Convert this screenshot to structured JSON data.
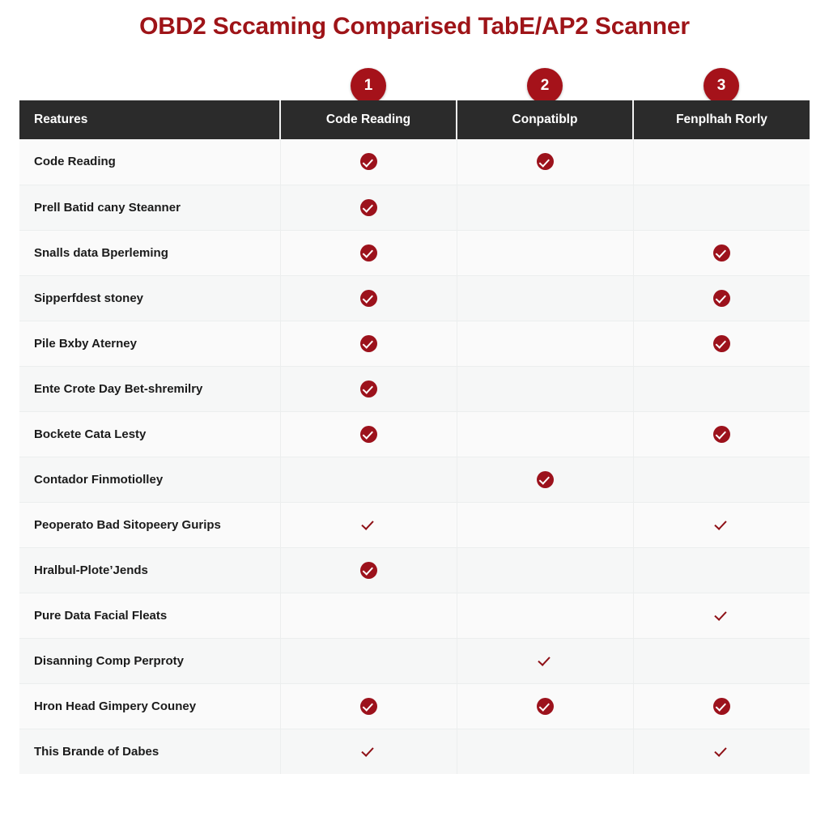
{
  "title": "OBD2 Sccaming Comparised TabE/AP2 Scanner",
  "colors": {
    "title": "#9e1418",
    "header_bar": "#2b2b2b",
    "badge": "#a5121a",
    "check": "#9c121c",
    "page_background": "#ffffff"
  },
  "badges": [
    {
      "label": "1"
    },
    {
      "label": "2"
    },
    {
      "label": "3"
    }
  ],
  "table": {
    "columns": [
      {
        "label": "Reatures",
        "type": "feature"
      },
      {
        "label": "Code Reading",
        "type": "mark"
      },
      {
        "label": "Conpatiblp",
        "type": "mark"
      },
      {
        "label": "Fenplhah Rorly",
        "type": "mark"
      }
    ],
    "rows": [
      {
        "feature": "Code Reading",
        "marks": [
          "circle",
          "circle",
          "none"
        ]
      },
      {
        "feature": "Prell Batid cany Steanner",
        "marks": [
          "circle",
          "none",
          "none"
        ]
      },
      {
        "feature": "Snalls data Bperleming",
        "marks": [
          "circle",
          "none",
          "circle"
        ]
      },
      {
        "feature": "Sipperfdest stoney",
        "marks": [
          "circle",
          "none",
          "circle"
        ]
      },
      {
        "feature": "Pile Bxby Aterney",
        "marks": [
          "circle",
          "none",
          "circle"
        ]
      },
      {
        "feature": "Ente Crote Day Bet-shremilry",
        "marks": [
          "circle",
          "none",
          "none"
        ]
      },
      {
        "feature": "Bockete Cata Lesty",
        "marks": [
          "circle",
          "none",
          "circle"
        ]
      },
      {
        "feature": "Contador Finmotiolley",
        "marks": [
          "none",
          "circle",
          "none"
        ]
      },
      {
        "feature": "Peoperato Bad Sitopeery Gurips",
        "marks": [
          "plain",
          "none",
          "plain"
        ]
      },
      {
        "feature": "Hralbul-Plote’Jends",
        "marks": [
          "circle",
          "none",
          "none"
        ]
      },
      {
        "feature": "Pure Data Facial Fleats",
        "marks": [
          "none",
          "none",
          "plain"
        ]
      },
      {
        "feature": "Disanning Comp Perproty",
        "marks": [
          "none",
          "plain",
          "none"
        ]
      },
      {
        "feature": "Hron Head Gimpery Couney",
        "marks": [
          "circle",
          "circle",
          "circle"
        ]
      },
      {
        "feature": "This Brande of Dabes",
        "marks": [
          "plain",
          "none",
          "plain"
        ]
      }
    ]
  }
}
